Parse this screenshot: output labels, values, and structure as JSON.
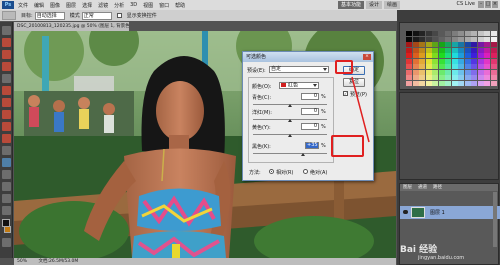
{
  "menubar": {
    "logo": "Ps",
    "items": [
      "文件",
      "编辑",
      "图像",
      "图层",
      "选择",
      "滤镜",
      "分析",
      "3D",
      "视图",
      "窗口",
      "帮助"
    ],
    "workspace": [
      "基本功能",
      "设计",
      "绘画"
    ],
    "cs_live": "CS Live",
    "window_controls": [
      "-",
      "□",
      "×"
    ]
  },
  "options": {
    "target_label": "目标:",
    "target_value": "自动选择",
    "mode_label": "模式",
    "mode_value": "正常",
    "show_transform_label": "显示变换控件"
  },
  "document": {
    "tab_title": "DSC_20100813_120235.jpg @ 50% (图层 1, 背景色/8) *",
    "status": [
      "50%",
      "文档:26.5M/53.0M"
    ]
  },
  "dialog": {
    "title": "可选颜色",
    "preset_label": "预设(E):",
    "preset_value": "自定",
    "colors_label": "颜色(O):",
    "colors_value": "红色",
    "cyan_label": "青色(C):",
    "cyan_value": "0",
    "magenta_label": "洋红(M):",
    "magenta_value": "0",
    "yellow_label": "黄色(Y):",
    "yellow_value": "0",
    "black_label": "黑色(K):",
    "black_value": "+35",
    "percent": "%",
    "method_label": "方法:",
    "relative_label": "相对(R)",
    "absolute_label": "绝对(A)",
    "ok_label": "确定",
    "reset_label": "复位",
    "preview_label": "预览(P)",
    "close_label": "×",
    "preview_checked": true,
    "method_selected": "relative"
  },
  "layers": {
    "tabs": [
      "图层",
      "通道",
      "路径"
    ],
    "layer_name": "图层 1"
  },
  "watermark": {
    "text": "Bai 经验",
    "url": "jingyan.baidu.com"
  },
  "colors": {
    "highlight_box": "#e02020",
    "selected_chip": "#d21f1f"
  }
}
